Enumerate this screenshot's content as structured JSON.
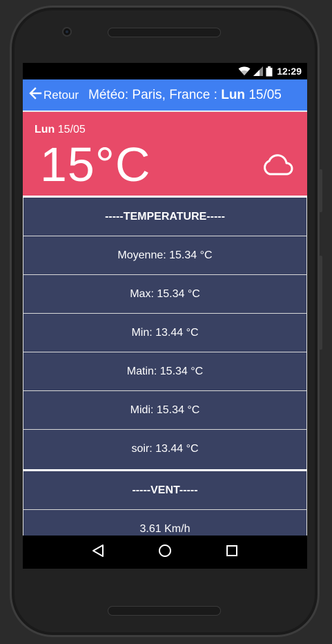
{
  "status_bar": {
    "time": "12:29",
    "icons": [
      "wifi-icon",
      "signal-icon",
      "battery-icon"
    ]
  },
  "app_bar": {
    "back_label": "Retour",
    "title_prefix": "Météo: Paris, France : ",
    "title_day": "Lun",
    "title_date": " 15/05",
    "back_icon": "arrow-left-icon"
  },
  "summary": {
    "day": "Lun",
    "date": " 15/05",
    "temperature": "15°C",
    "weather_icon": "cloud-icon",
    "background_color": "#e84a68"
  },
  "sections": {
    "temperature": {
      "header": "-----TEMPERATURE-----",
      "rows": [
        "Moyenne: 15.34 °C",
        "Max: 15.34 °C",
        "Min: 13.44 °C",
        "Matin: 15.34 °C",
        "Midi: 15.34 °C",
        "soir: 13.44 °C"
      ]
    },
    "wind": {
      "header": "-----VENT-----",
      "rows": [
        "3.61 Km/h"
      ]
    }
  },
  "nav_bar": {
    "icons": [
      "back-triangle-icon",
      "home-circle-icon",
      "recents-square-icon"
    ]
  },
  "colors": {
    "app_bar": "#3f7ff2",
    "section_bg": "#394162"
  }
}
